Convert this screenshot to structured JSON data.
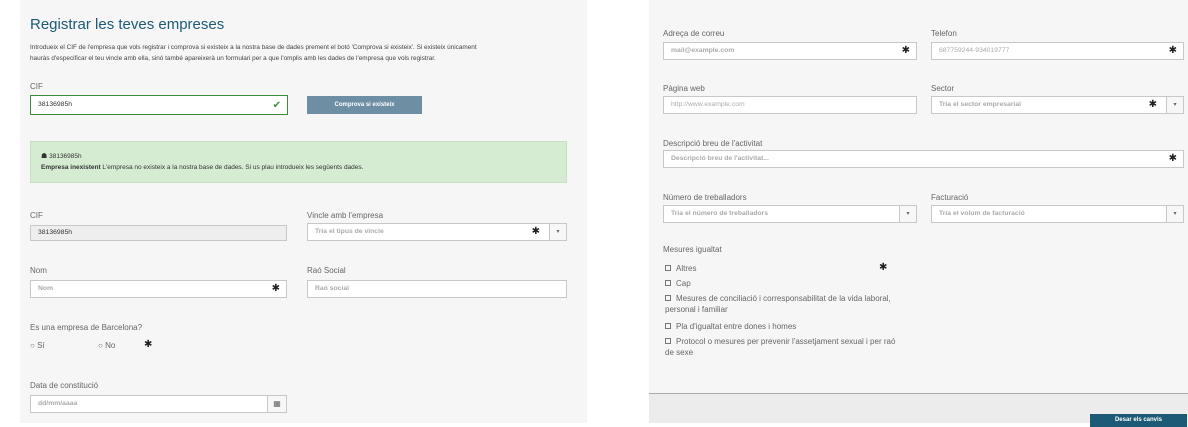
{
  "left": {
    "title": "Registrar les teves empreses",
    "intro_line1": "Introdueix el CIF de l'empresa que vols registrar i comprova si existeix a la nostra base de dades prement el botó 'Comprova si existeix'. Si existeix únicament",
    "intro_line2": "hauràs d'especificar el teu vincle amb ella, sinó també apareixerà un formulari per a que l'omplis amb les dades de l'empresa que vols registrar.",
    "cif_label": "CIF",
    "cif_value": "38136985h",
    "check_button": "Comprova si existeix",
    "alert_cif": "38136985h",
    "alert_bold": "Empresa inexistent",
    "alert_text": " L'empresa no existeix a la nostra base de dades. Si us plau introdueix les següents dades.",
    "cif2_label": "CIF",
    "cif2_value": "38136985h",
    "vincle_label": "Vincle amb l'empresa",
    "vincle_placeholder": "Tria el tipus de vincle",
    "nom_label": "Nom",
    "nom_placeholder": "Nom",
    "rao_label": "Raó Social",
    "rao_placeholder": "Raó social",
    "barcelona_label": "Es una empresa de Barcelona?",
    "radio_si": "Sí",
    "radio_no": "No",
    "data_label": "Data de constitució",
    "data_placeholder": "dd/mm/aaaa"
  },
  "right": {
    "email_label": "Adreça de correu",
    "email_placeholder": "mail@example.com",
    "telefon_label": "Telefon",
    "telefon_placeholder": "687759244-934019777",
    "web_label": "Pàgina web",
    "web_placeholder": "http://www.example.com",
    "sector_label": "Sector",
    "sector_placeholder": "Tria el sector empresarial",
    "desc_label": "Descripció breu de l'activitat",
    "desc_placeholder": "Descripció breu de l'activitat...",
    "treb_label": "Número de treballadors",
    "treb_placeholder": "Tria el número de treballadors",
    "fact_label": "Facturació",
    "fact_placeholder": "Tria el volum de facturació",
    "mesures_label": "Mesures igualtat",
    "mesures": [
      "Altres",
      "Cap",
      "Mesures de conciliació i corresponsabilitat de la vida laboral, personal i familiar",
      "Pla d'igualtat entre dones i homes",
      "Protocol o mesures per prevenir l'assetjament sexual i per raó de sexe"
    ],
    "save_button": "Desar els canvis"
  },
  "colors": {
    "accent": "#1d5a76",
    "button": "#6e8ea3",
    "success_bg": "#d5ecd2",
    "valid_border": "#3c8a3c"
  },
  "icons": {
    "valid": "checkmark-icon",
    "calendar": "calendar-icon",
    "required": "asterisk-icon",
    "dropdown": "caret-down-icon",
    "alert": "building-icon"
  }
}
